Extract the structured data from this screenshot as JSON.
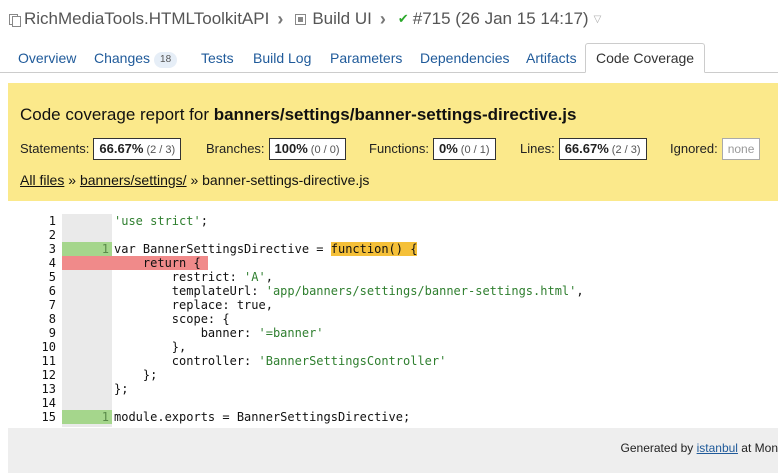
{
  "breadcrumb": {
    "project": "RichMediaTools.HTMLToolkitAPI",
    "build_config": "Build UI",
    "build": "#715 (26 Jan 15 14:17)"
  },
  "tabs": [
    {
      "label": "Overview"
    },
    {
      "label": "Changes",
      "count": "18"
    },
    {
      "label": "Tests"
    },
    {
      "label": "Build Log"
    },
    {
      "label": "Parameters"
    },
    {
      "label": "Dependencies"
    },
    {
      "label": "Artifacts"
    },
    {
      "label": "Code Coverage",
      "active": true
    }
  ],
  "coverage": {
    "title_prefix": "Code coverage report for ",
    "file": "banners/settings/banner-settings-directive.js",
    "stats": {
      "statements": {
        "label": "Statements:",
        "pct": "66.67%",
        "frac": "(2 / 3)"
      },
      "branches": {
        "label": "Branches:",
        "pct": "100%",
        "frac": "(0 / 0)"
      },
      "functions": {
        "label": "Functions:",
        "pct": "0%",
        "frac": "(0 / 1)"
      },
      "lines": {
        "label": "Lines:",
        "pct": "66.67%",
        "frac": "(2 / 3)"
      },
      "ignored": {
        "label": "Ignored:",
        "value": "none"
      }
    },
    "path": {
      "all_files": "All files",
      "sep1": "»",
      "dir": "banners/settings/",
      "sep2": "»",
      "file": "banner-settings-directive.js"
    }
  },
  "code": {
    "lines": [
      {
        "n": "1",
        "hits": "",
        "text": "'use strict';"
      },
      {
        "n": "2",
        "hits": "",
        "text": ""
      },
      {
        "n": "3",
        "hits": "1",
        "text": "var BannerSettingsDirective = function() {"
      },
      {
        "n": "4",
        "hits": "",
        "text": "    return {"
      },
      {
        "n": "5",
        "hits": "",
        "text": "        restrict: 'A',"
      },
      {
        "n": "6",
        "hits": "",
        "text": "        templateUrl: 'app/banners/settings/banner-settings.html',"
      },
      {
        "n": "7",
        "hits": "",
        "text": "        replace: true,"
      },
      {
        "n": "8",
        "hits": "",
        "text": "        scope: {"
      },
      {
        "n": "9",
        "hits": "",
        "text": "            banner: '=banner'"
      },
      {
        "n": "10",
        "hits": "",
        "text": "        },"
      },
      {
        "n": "11",
        "hits": "",
        "text": "        controller: 'BannerSettingsController'"
      },
      {
        "n": "12",
        "hits": "",
        "text": "    };"
      },
      {
        "n": "13",
        "hits": "",
        "text": "};"
      },
      {
        "n": "14",
        "hits": "",
        "text": ""
      },
      {
        "n": "15",
        "hits": "1",
        "text": "module.exports = BannerSettingsDirective;"
      }
    ]
  },
  "footer": {
    "prefix": "Generated by ",
    "link": "istanbul",
    "suffix": " at Mon"
  },
  "colors": {
    "header_bg": "#fbe98b",
    "covered": "#a5d68c",
    "uncovered": "#f08a8a",
    "fn_uncovered": "#f5c038"
  }
}
